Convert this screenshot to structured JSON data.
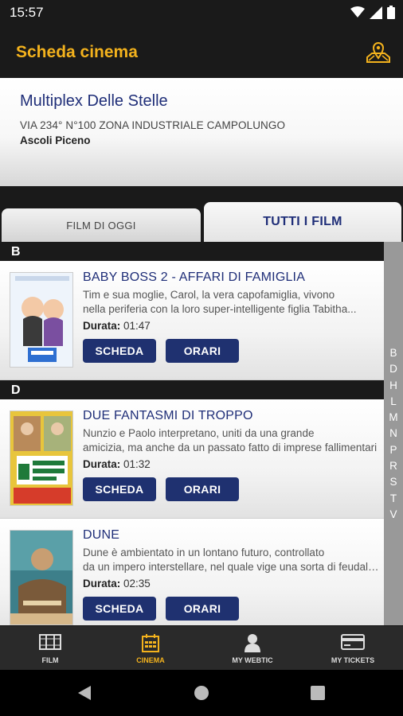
{
  "status": {
    "time": "15:57"
  },
  "appbar": {
    "title": "Scheda cinema",
    "map_icon": "map-pin-icon"
  },
  "cinema": {
    "name": "Multiplex Delle Stelle",
    "address": "VIA 234° N°100 ZONA INDUSTRIALE CAMPOLUNGO",
    "city": "Ascoli Piceno"
  },
  "tabs": {
    "today": "FILM DI OGGI",
    "all": "TUTTI I FILM"
  },
  "sections": [
    {
      "letter": "B",
      "movies": [
        {
          "title": "BABY BOSS 2 - AFFARI DI FAMIGLIA",
          "desc1": "Tim e sua moglie, Carol, la vera capofamiglia, vivono",
          "desc2": "nella periferia con la loro super-intelligente figlia Tabitha...",
          "duration_label": "Durata:",
          "duration": "01:47",
          "scheda": "SCHEDA",
          "orari": "ORARI"
        }
      ]
    },
    {
      "letter": "D",
      "movies": [
        {
          "title": "DUE FANTASMI DI TROPPO",
          "desc1": "Nunzio e Paolo interpretano, uniti da una grande",
          "desc2": "amicizia, ma anche da un passato fatto di imprese fallimentari",
          "duration_label": "Durata:",
          "duration": "01:32",
          "scheda": "SCHEDA",
          "orari": "ORARI"
        },
        {
          "title": "DUNE",
          "desc1": "Dune è ambientato in un lontano futuro, controllato",
          "desc2": "da un impero interstellare, nel quale vige una sorta di feudalesimo",
          "duration_label": "Durata:",
          "duration": "02:35",
          "scheda": "SCHEDA",
          "orari": "ORARI"
        }
      ]
    }
  ],
  "alphabet": [
    "B",
    "D",
    "H",
    "L",
    "M",
    "N",
    "P",
    "R",
    "S",
    "T",
    "V"
  ],
  "bottomnav": [
    {
      "label": "FILM",
      "icon": "film-strip-icon",
      "active": false
    },
    {
      "label": "CINEMA",
      "icon": "calendar-icon",
      "active": true
    },
    {
      "label": "MY WEBTIC",
      "icon": "user-icon",
      "active": false
    },
    {
      "label": "MY TICKETS",
      "icon": "credit-card-icon",
      "active": false
    }
  ],
  "colors": {
    "accent": "#f3b21d",
    "brand_blue": "#1f2e78",
    "button": "#1f3170"
  }
}
